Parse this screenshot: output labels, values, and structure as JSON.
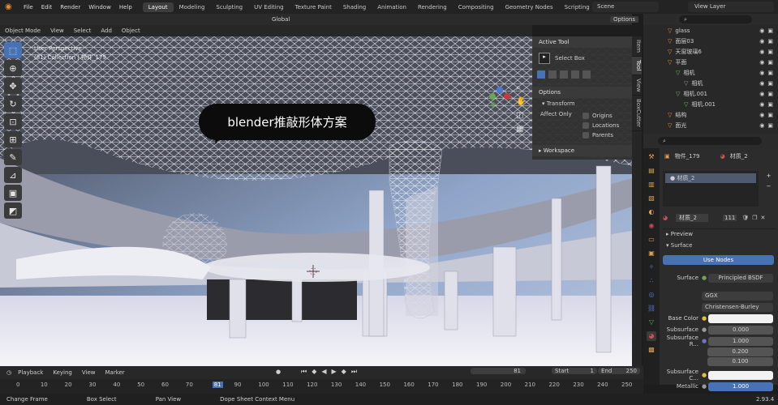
{
  "menu": [
    "File",
    "Edit",
    "Render",
    "Window",
    "Help"
  ],
  "workspaces": [
    "Layout",
    "Modeling",
    "Sculpting",
    "UV Editing",
    "Texture Paint",
    "Shading",
    "Animation",
    "Rendering",
    "Compositing",
    "Geometry Nodes",
    "Scripting"
  ],
  "scene": "Scene",
  "view_layer": "View Layer",
  "header": {
    "transform": "Global",
    "options": "Options"
  },
  "viewport_header": [
    "Object Mode",
    "View",
    "Select",
    "Add",
    "Object"
  ],
  "viewport_info": {
    "perspective": "User Perspective",
    "collection": "(81) Collection | 物件_179"
  },
  "bubble_text": "blender推敲形体方案",
  "npanel": {
    "active_tool_title": "Active Tool",
    "tool_name": "Select Box",
    "options_title": "Options",
    "transform_title": "Transform",
    "affect_only": "Affect Only",
    "checkboxes": [
      "Origins",
      "Locations",
      "Parents"
    ],
    "workspace_title": "Workspace"
  },
  "side_tabs": [
    "Item",
    "Tool",
    "View",
    "BoxCutter"
  ],
  "outliner": [
    {
      "name": "glass",
      "icon_color": "#e8963a"
    },
    {
      "name": "面层03",
      "icon_color": "#e8963a"
    },
    {
      "name": "天窗玻璃6",
      "icon_color": "#e8963a"
    },
    {
      "name": "平面",
      "icon_color": "#e8963a"
    },
    {
      "name": "相机",
      "icon_color": "#76b36a"
    },
    {
      "name": "相机",
      "icon_color": "#76b36a"
    },
    {
      "name": "相机.001",
      "icon_color": "#76b36a"
    },
    {
      "name": "相机.001",
      "icon_color": "#76b36a"
    },
    {
      "name": "结构",
      "icon_color": "#e8963a"
    },
    {
      "name": "面光",
      "icon_color": "#e8963a"
    }
  ],
  "props": {
    "object_name": "物件_179",
    "material_name": "材质_2",
    "slot_name": "材质_2",
    "user_count": "111",
    "preview": "Preview",
    "surface_section": "Surface",
    "use_nodes": "Use Nodes",
    "surface_label": "Surface",
    "surface_value": "Principled BSDF",
    "distribution": "GGX",
    "sss_method": "Christensen-Burley",
    "base_color_label": "Base Color",
    "subsurface_label": "Subsurface",
    "subsurface_value": "0.000",
    "subsurface_radius_label": "Subsurface R...",
    "subsurface_radius": [
      "1.000",
      "0.200",
      "0.100"
    ],
    "subsurface_color_label": "Subsurface C...",
    "metallic_label": "Metallic",
    "metallic_value": "1.000"
  },
  "timeline": {
    "menu": [
      "Playback",
      "Keying",
      "View",
      "Marker"
    ],
    "current_frame": "81",
    "start_label": "Start",
    "start": "1",
    "end_label": "End",
    "end": "250",
    "ruler": [
      "0",
      "10",
      "20",
      "30",
      "40",
      "50",
      "60",
      "70",
      "81",
      "90",
      "100",
      "110",
      "120",
      "130",
      "140",
      "150",
      "160",
      "170",
      "180",
      "190",
      "200",
      "210",
      "220",
      "230",
      "240",
      "250"
    ]
  },
  "statusbar": [
    "Change Frame",
    "Box Select",
    "Pan View",
    "Dope Sheet Context Menu"
  ],
  "version": "2.93.4"
}
